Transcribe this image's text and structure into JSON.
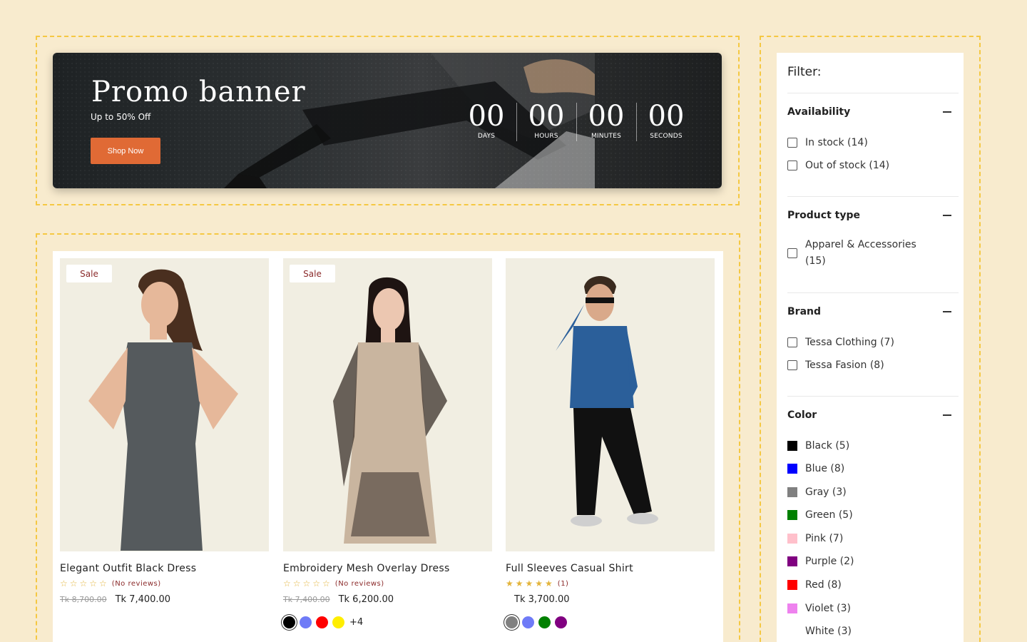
{
  "banner": {
    "title": "Promo banner",
    "subtitle": "Up to 50% Off",
    "button": "Shop Now",
    "countdown": [
      {
        "value": "00",
        "label": "DAYS"
      },
      {
        "value": "00",
        "label": "HOURS"
      },
      {
        "value": "00",
        "label": "MINUTES"
      },
      {
        "value": "00",
        "label": "SECONDS"
      }
    ]
  },
  "products": [
    {
      "badge": "Sale",
      "title": "Elegant Outfit Black Dress",
      "stars": "☆☆☆☆☆",
      "reviews": "(No reviews)",
      "old_price": "Tk 8,700.00",
      "price": "Tk 7,400.00"
    },
    {
      "badge": "Sale",
      "title": "Embroidery Mesh Overlay Dress",
      "stars": "☆☆☆☆☆",
      "reviews": "(No reviews)",
      "old_price": "Tk 7,400.00",
      "price": "Tk 6,200.00",
      "swatches": [
        "#000000",
        "#6f7bf7",
        "#ff0000",
        "#ffee00"
      ],
      "more": "+4"
    },
    {
      "badge": "",
      "title": "Full Sleeves Casual Shirt",
      "stars": "★★★★★",
      "reviews": "(1)",
      "old_price": "",
      "price": "Tk 3,700.00",
      "swatches": [
        "#808080",
        "#6f7bf7",
        "#008000",
        "#800080"
      ]
    }
  ],
  "filter": {
    "title": "Filter:",
    "availability": {
      "label": "Availability",
      "options": [
        "In stock (14)",
        "Out of stock (14)"
      ]
    },
    "product_type": {
      "label": "Product type",
      "option_line1": "Apparel & Accessories",
      "option_line2": "(15)"
    },
    "brand": {
      "label": "Brand",
      "options": [
        "Tessa Clothing (7)",
        "Tessa Fasion (8)"
      ]
    },
    "color": {
      "label": "Color",
      "options": [
        {
          "label": "Black (5)",
          "color": "#000000"
        },
        {
          "label": "Blue (8)",
          "color": "#0000ff"
        },
        {
          "label": "Gray (3)",
          "color": "#808080"
        },
        {
          "label": "Green (5)",
          "color": "#008000"
        },
        {
          "label": "Pink (7)",
          "color": "#ffc0cb"
        },
        {
          "label": "Purple (2)",
          "color": "#800080"
        },
        {
          "label": "Red (8)",
          "color": "#ff0000"
        },
        {
          "label": "Violet (3)",
          "color": "#ee82ee"
        },
        {
          "label": "White (3)",
          "color": "#ffffff"
        }
      ]
    }
  }
}
